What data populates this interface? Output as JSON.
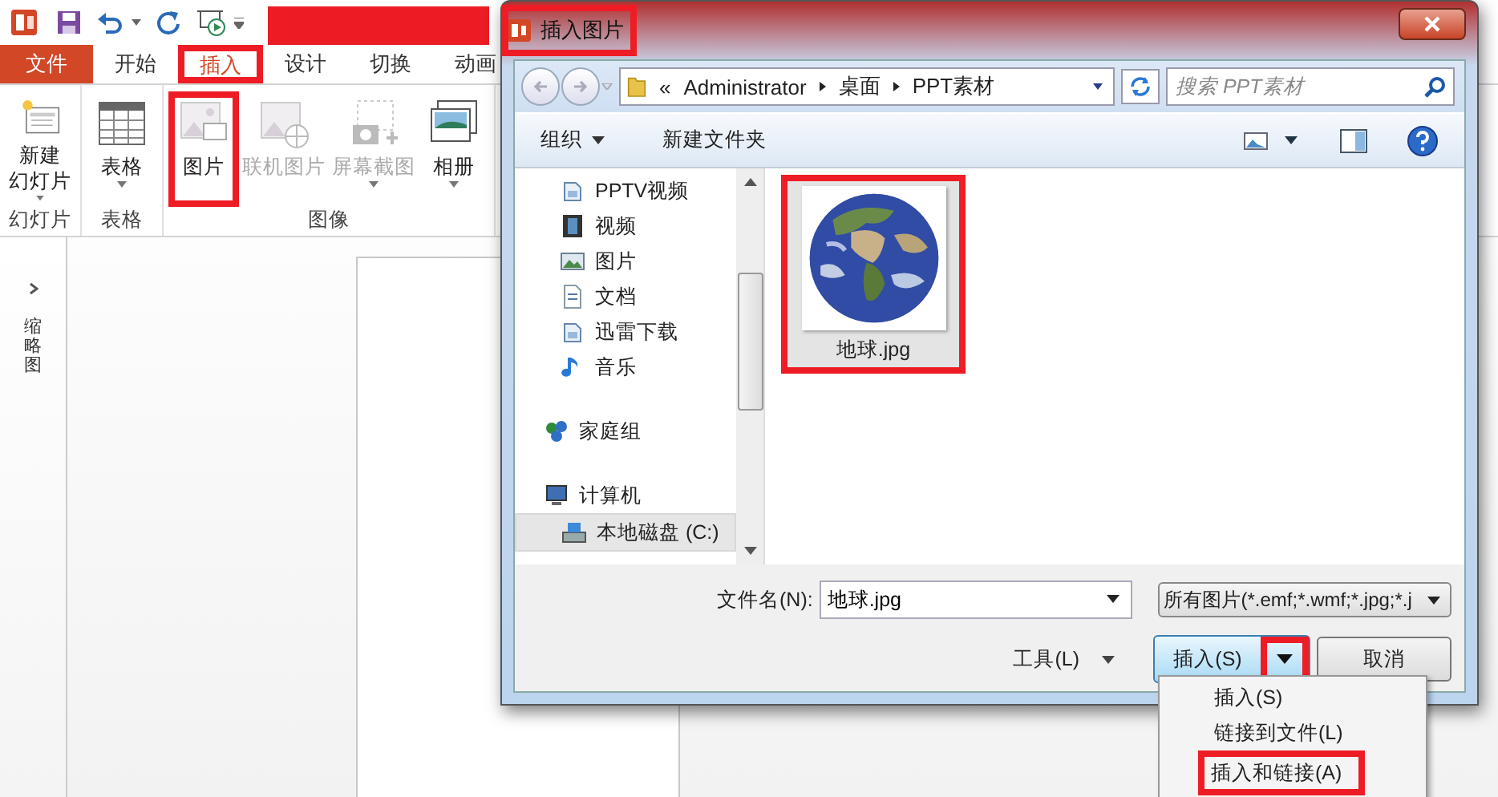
{
  "title_redacted": true,
  "ribbon_tabs": [
    {
      "label": "文件",
      "kind": "file",
      "selected": false,
      "highlighted": false
    },
    {
      "label": "开始",
      "kind": "tab",
      "selected": false,
      "highlighted": false
    },
    {
      "label": "插入",
      "kind": "tab",
      "selected": true,
      "highlighted": true
    },
    {
      "label": "设计",
      "kind": "tab",
      "selected": false,
      "highlighted": false
    },
    {
      "label": "切换",
      "kind": "tab",
      "selected": false,
      "highlighted": false
    },
    {
      "label": "动画",
      "kind": "tab",
      "selected": false,
      "highlighted": false
    }
  ],
  "ribbon_groups": [
    {
      "label": "幻灯片",
      "buttons": [
        {
          "lines": [
            "新建",
            "幻灯片"
          ],
          "disabled": false,
          "has_menu": true,
          "highlighted": false
        }
      ]
    },
    {
      "label": "表格",
      "buttons": [
        {
          "lines": [
            "表格"
          ],
          "disabled": false,
          "has_menu": true,
          "highlighted": false
        }
      ]
    },
    {
      "label": "图像",
      "buttons": [
        {
          "lines": [
            "图片"
          ],
          "disabled": false,
          "has_menu": false,
          "highlighted": true
        },
        {
          "lines": [
            "联机图片"
          ],
          "disabled": true,
          "has_menu": false,
          "highlighted": false
        },
        {
          "lines": [
            "屏幕截图"
          ],
          "disabled": true,
          "has_menu": true,
          "highlighted": false
        },
        {
          "lines": [
            "相册"
          ],
          "disabled": false,
          "has_menu": true,
          "highlighted": false
        }
      ]
    }
  ],
  "thumbnails_pane": {
    "label": "缩略图"
  },
  "dialog": {
    "title": "插入图片",
    "title_highlighted": true,
    "breadcrumb_overflow": "«",
    "breadcrumb": [
      "Administrator",
      "桌面",
      "PPT素材"
    ],
    "search_placeholder": "搜索 PPT素材",
    "toolbar": [
      {
        "label": "组织",
        "has_menu": true
      },
      {
        "label": "新建文件夹",
        "has_menu": false
      }
    ],
    "nav_tree": [
      {
        "children": [
          {
            "label": "PPTV视频",
            "selected": false
          },
          {
            "label": "视频",
            "selected": false
          },
          {
            "label": "图片",
            "selected": false
          },
          {
            "label": "文档",
            "selected": false
          },
          {
            "label": "迅雷下载",
            "selected": false
          },
          {
            "label": "音乐",
            "selected": false
          }
        ]
      },
      {
        "label": "家庭组",
        "selected": false
      },
      {
        "label": "计算机",
        "selected": false,
        "children": [
          {
            "label": "本地磁盘 (C:)",
            "selected": true
          }
        ]
      }
    ],
    "files": [
      {
        "name": "地球.jpg",
        "kind": "picture",
        "selected": true,
        "highlighted": true
      }
    ],
    "filename_label": "文件名(N):",
    "filename": "地球.jpg",
    "file_type": "所有图片(*.emf;*.wmf;*.jpg;*.j",
    "tools": "工具(L)",
    "insert_button": "插入(S)",
    "insert_menu_highlighted": true,
    "cancel_button": "取消",
    "insert_menu": [
      {
        "label": "插入(S)",
        "highlighted": false
      },
      {
        "label": "链接到文件(L)",
        "highlighted": false
      },
      {
        "label": "插入和链接(A)",
        "highlighted": true
      }
    ]
  }
}
